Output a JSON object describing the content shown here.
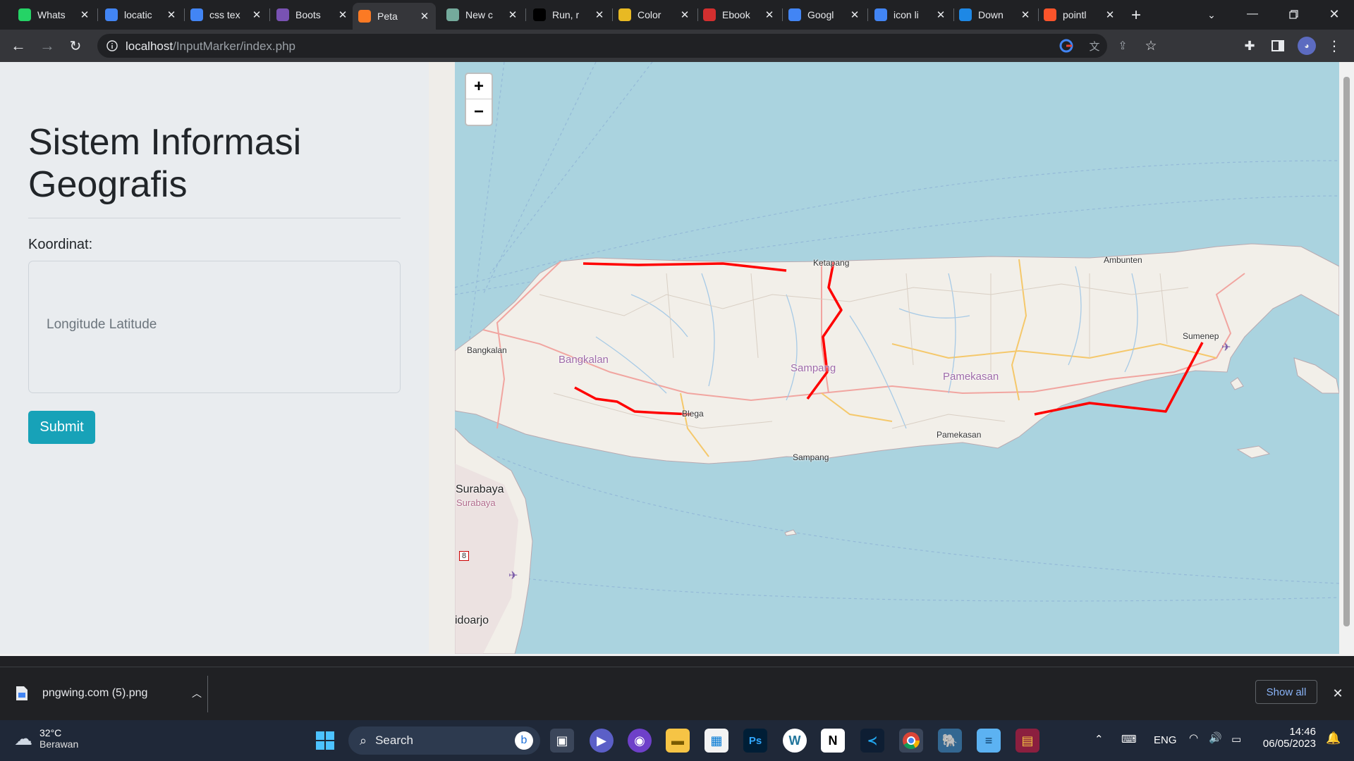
{
  "browser": {
    "tabs": [
      {
        "label": "Whats",
        "icon": "whatsapp-icon",
        "color": "#25d366"
      },
      {
        "label": "locatic",
        "icon": "google-icon",
        "color": "#4285f4"
      },
      {
        "label": "css tex",
        "icon": "google-icon",
        "color": "#4285f4"
      },
      {
        "label": "Boots",
        "icon": "bootstrap-icon",
        "color": "#7952b3"
      },
      {
        "label": "Peta",
        "icon": "xampp-icon",
        "color": "#fb7a24",
        "active": true
      },
      {
        "label": "New c",
        "icon": "chatgpt-icon",
        "color": "#74aa9c"
      },
      {
        "label": "Run, r",
        "icon": "github-icon",
        "color": "#000000"
      },
      {
        "label": "Color",
        "icon": "palette-icon",
        "color": "#e8b923"
      },
      {
        "label": "Ebook",
        "icon": "pdf-icon",
        "color": "#d32f2f"
      },
      {
        "label": "Googl",
        "icon": "google-translate-icon",
        "color": "#4285f4"
      },
      {
        "label": "icon li",
        "icon": "google-icon",
        "color": "#4285f4"
      },
      {
        "label": "Down",
        "icon": "download-site-icon",
        "color": "#1e88e5"
      },
      {
        "label": "pointl",
        "icon": "brave-icon",
        "color": "#fb542b"
      }
    ],
    "url_host": "localhost",
    "url_path": "/InputMarker/index.php"
  },
  "page": {
    "title": "Sistem Informasi Geografis",
    "coord_label": "Koordinat:",
    "coord_placeholder": "Longitude Latitude",
    "submit_label": "Submit"
  },
  "map": {
    "zoom_in_label": "+",
    "zoom_out_label": "−",
    "labels": {
      "ketapang": "Ketapang",
      "ambunten": "Ambunten",
      "sumenep": "Sumenep",
      "bangkalan_town": "Bangkalan",
      "bangkalan_region": "Bangkalan",
      "sampang_region": "Sampang",
      "pamekasan_region": "Pamekasan",
      "blega": "Blega",
      "pamekasan_town": "Pamekasan",
      "sampang_town": "Sampang",
      "surabaya_city": "Surabaya",
      "surabaya_region": "Surabaya",
      "road_8": "8",
      "sidoarjo": "idoarjo"
    },
    "colors": {
      "water": "#aad3df",
      "land": "#f2efe9",
      "route": "#ff0000"
    }
  },
  "download": {
    "filename": "pngwing.com (5).png",
    "show_all": "Show all"
  },
  "taskbar": {
    "weather_temp": "32°C",
    "weather_desc": "Berawan",
    "search_label": "Search",
    "language": "ENG",
    "time": "14:46",
    "date": "06/05/2023"
  }
}
